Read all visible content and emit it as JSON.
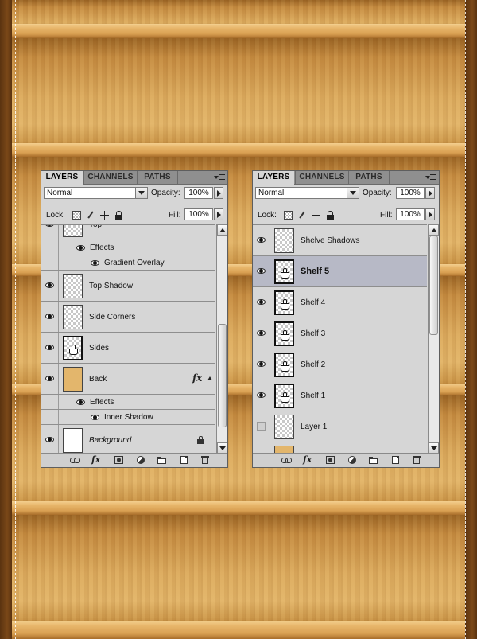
{
  "panels": {
    "left": {
      "tabs": [
        "LAYERS",
        "CHANNELS",
        "PATHS"
      ],
      "blend_mode": "Normal",
      "opacity_label": "Opacity:",
      "opacity_value": "100%",
      "lock_label": "Lock:",
      "fill_label": "Fill:",
      "fill_value": "100%",
      "rows": [
        {
          "type": "layer",
          "name": "Top",
          "thumb": "checker",
          "eye": true
        },
        {
          "type": "effects",
          "name": "Effects"
        },
        {
          "type": "effect",
          "name": "Gradient Overlay"
        },
        {
          "type": "layer",
          "name": "Top Shadow",
          "thumb": "checker",
          "eye": true
        },
        {
          "type": "layer",
          "name": "Side Corners",
          "thumb": "checker",
          "eye": true
        },
        {
          "type": "layer",
          "name": "Sides",
          "thumb": "linked-checker",
          "eye": true
        },
        {
          "type": "layer",
          "name": "Back",
          "thumb": "tan",
          "eye": true,
          "fx": "fx"
        },
        {
          "type": "effects",
          "name": "Effects"
        },
        {
          "type": "effect",
          "name": "Inner Shadow"
        },
        {
          "type": "layer",
          "name": "Background",
          "thumb": "white",
          "eye": true,
          "italic": true,
          "locked": true
        }
      ],
      "scroll_level": 0.85,
      "footer_fx": "fx"
    },
    "right": {
      "tabs": [
        "LAYERS",
        "CHANNELS",
        "PATHS"
      ],
      "blend_mode": "Normal",
      "opacity_label": "Opacity:",
      "opacity_value": "100%",
      "lock_label": "Lock:",
      "fill_label": "Fill:",
      "fill_value": "100%",
      "rows": [
        {
          "type": "layer",
          "name": "Shelve Shadows",
          "thumb": "checker",
          "eye": true
        },
        {
          "type": "layer",
          "name": "Shelf 5",
          "thumb": "linked-checker",
          "eye": true,
          "selected": true
        },
        {
          "type": "layer",
          "name": "Shelf 4",
          "thumb": "linked-checker",
          "eye": true
        },
        {
          "type": "layer",
          "name": "Shelf 3",
          "thumb": "linked-checker",
          "eye": true
        },
        {
          "type": "layer",
          "name": "Shelf 2",
          "thumb": "linked-checker",
          "eye": true
        },
        {
          "type": "layer",
          "name": "Shelf 1",
          "thumb": "linked-checker",
          "eye": true
        },
        {
          "type": "layer",
          "name": "Layer 1",
          "thumb": "checker",
          "eye": false
        },
        {
          "type": "layer",
          "name": "",
          "thumb": "tan",
          "eye": true
        }
      ],
      "scroll_level": 0.0,
      "footer_fx": "fx"
    }
  },
  "colors": {
    "panel_bg": "#d6d6d6",
    "selected_row": "#b7b9c6",
    "wood": "#dcab5e"
  }
}
